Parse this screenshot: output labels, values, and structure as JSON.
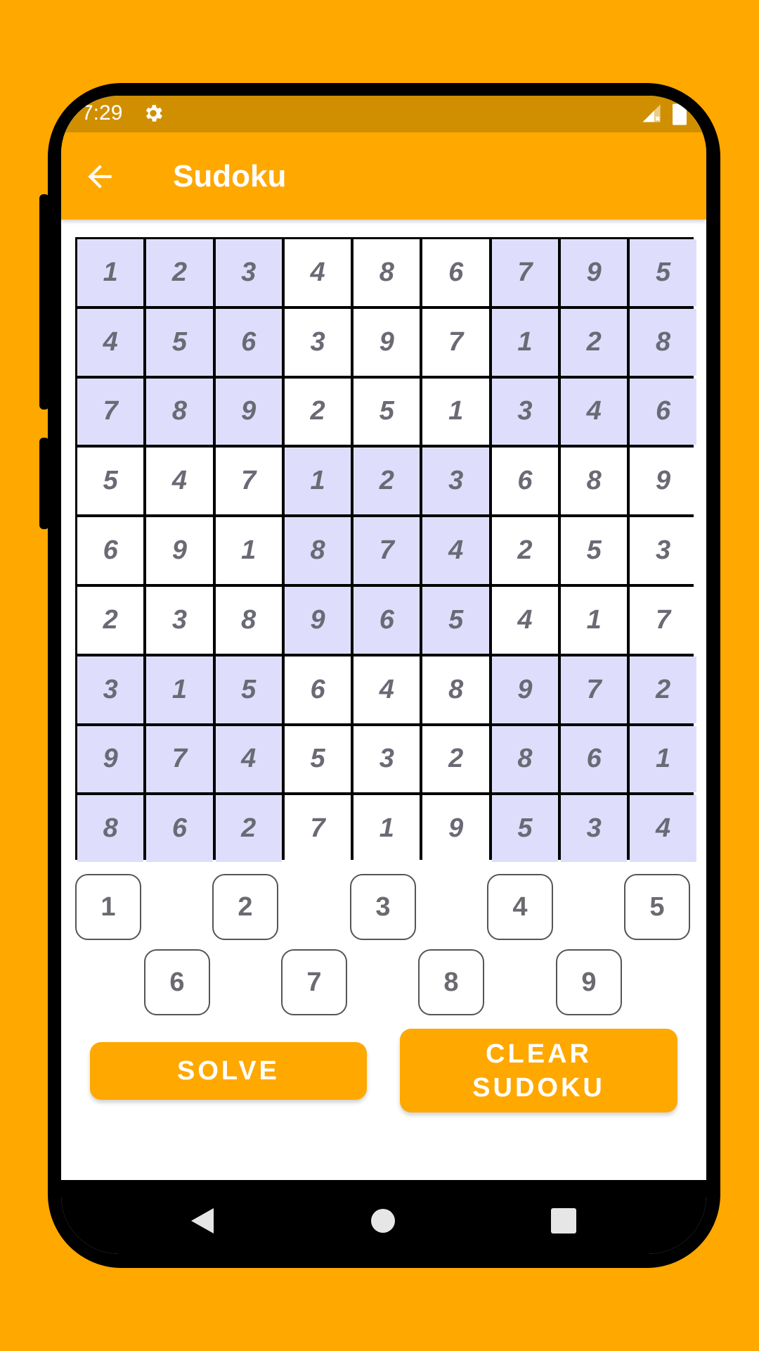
{
  "status_bar": {
    "time": "7:29",
    "icons": [
      "gear-icon",
      "signal-icon",
      "battery-icon"
    ]
  },
  "app_bar": {
    "title": "Sudoku",
    "back_icon": "arrow-left-icon"
  },
  "board": {
    "rows": [
      [
        "1",
        "2",
        "3",
        "4",
        "8",
        "6",
        "7",
        "9",
        "5"
      ],
      [
        "4",
        "5",
        "6",
        "3",
        "9",
        "7",
        "1",
        "2",
        "8"
      ],
      [
        "7",
        "8",
        "9",
        "2",
        "5",
        "1",
        "3",
        "4",
        "6"
      ],
      [
        "5",
        "4",
        "7",
        "1",
        "2",
        "3",
        "6",
        "8",
        "9"
      ],
      [
        "6",
        "9",
        "1",
        "8",
        "7",
        "4",
        "2",
        "5",
        "3"
      ],
      [
        "2",
        "3",
        "8",
        "9",
        "6",
        "5",
        "4",
        "1",
        "7"
      ],
      [
        "3",
        "1",
        "5",
        "6",
        "4",
        "8",
        "9",
        "7",
        "2"
      ],
      [
        "9",
        "7",
        "4",
        "5",
        "3",
        "2",
        "8",
        "6",
        "1"
      ],
      [
        "8",
        "6",
        "2",
        "7",
        "1",
        "9",
        "5",
        "3",
        "4"
      ]
    ],
    "shaded_color": "#DEDEFC"
  },
  "number_pad": [
    "1",
    "2",
    "3",
    "4",
    "5",
    "6",
    "7",
    "8",
    "9"
  ],
  "actions": {
    "solve_label": "SOLVE",
    "clear_label": "CLEAR SUDOKU"
  },
  "nav_bar": {
    "icons": [
      "back-triangle-icon",
      "home-circle-icon",
      "recents-square-icon"
    ]
  },
  "colors": {
    "accent": "#FFA800",
    "status_bar": "#D08F00"
  }
}
